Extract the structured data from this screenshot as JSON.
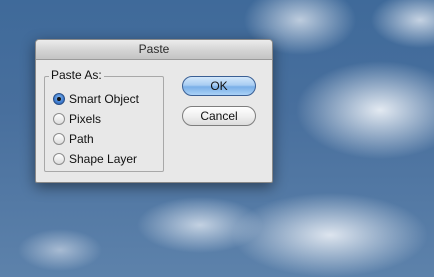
{
  "dialog": {
    "title": "Paste",
    "group_label": "Paste As:",
    "options": [
      {
        "label": "Smart Object",
        "checked": true
      },
      {
        "label": "Pixels",
        "checked": false
      },
      {
        "label": "Path",
        "checked": false
      },
      {
        "label": "Shape Layer",
        "checked": false
      }
    ],
    "ok_label": "OK",
    "cancel_label": "Cancel"
  }
}
